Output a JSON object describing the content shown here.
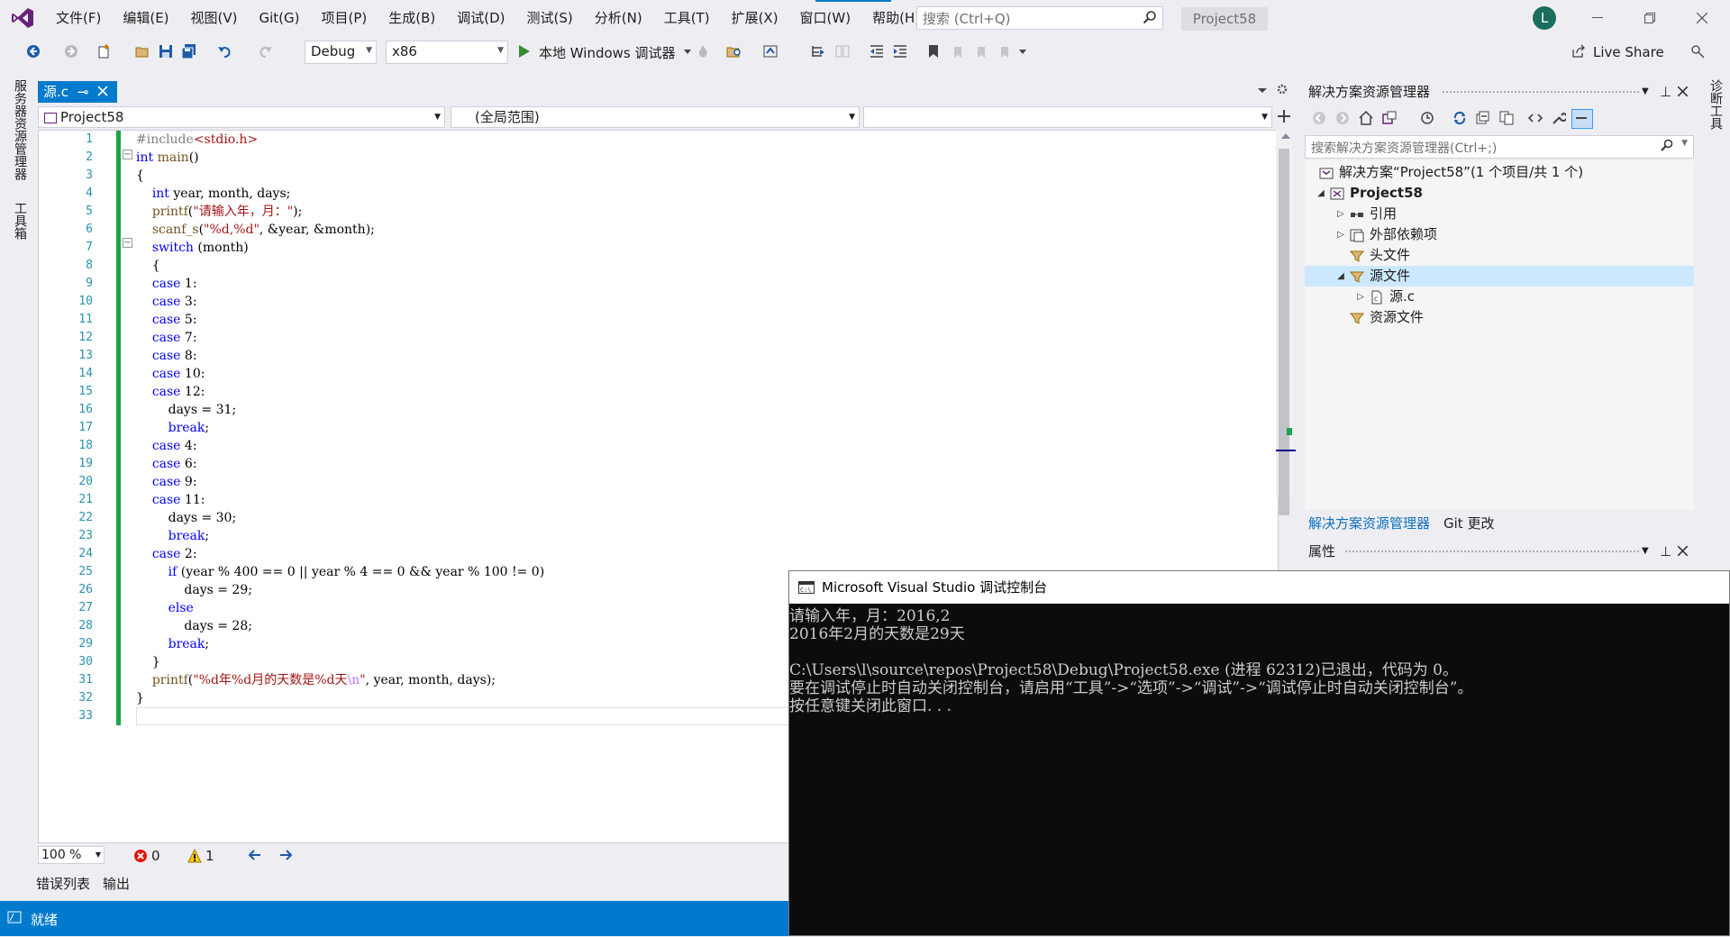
{
  "menu": {
    "items": [
      "文件(F)",
      "编辑(E)",
      "视图(V)",
      "Git(G)",
      "项目(P)",
      "生成(B)",
      "调试(D)",
      "测试(S)",
      "分析(N)",
      "工具(T)",
      "扩展(X)",
      "窗口(W)",
      "帮助(H)"
    ]
  },
  "search": {
    "placeholder": "搜索 (Ctrl+Q)"
  },
  "title": {
    "project": "Project58",
    "avatar_letter": "L"
  },
  "toolbar": {
    "config": "Debug",
    "platform": "x86",
    "run_label": "本地 Windows 调试器",
    "live_share": "Live Share"
  },
  "left_tabs": [
    "服务器资源管理器",
    "工具箱"
  ],
  "editor": {
    "tab_label": "源.c",
    "nav_project": "Project58",
    "nav_scope": "(全局范围)",
    "nav_member": "",
    "zoom": "100 %",
    "errors": "0",
    "warnings": "1",
    "line_numbers": [
      "1",
      "2",
      "3",
      "4",
      "5",
      "6",
      "7",
      "8",
      "9",
      "10",
      "11",
      "12",
      "13",
      "14",
      "15",
      "16",
      "17",
      "18",
      "19",
      "20",
      "21",
      "22",
      "23",
      "24",
      "25",
      "26",
      "27",
      "28",
      "29",
      "30",
      "31",
      "32",
      "33"
    ]
  },
  "bottom_tabs": [
    "错误列表",
    "输出"
  ],
  "status": {
    "text": "就绪"
  },
  "solution_explorer": {
    "title": "解决方案资源管理器",
    "search_placeholder": "搜索解决方案资源管理器(Ctrl+;)",
    "tree": [
      {
        "label": "解决方案“Project58”(1 个项目/共 1 个)"
      },
      {
        "label": "Project58"
      },
      {
        "label": "引用"
      },
      {
        "label": "外部依赖项"
      },
      {
        "label": "头文件"
      },
      {
        "label": "源文件"
      },
      {
        "label": "源.c"
      },
      {
        "label": "资源文件"
      }
    ],
    "tabs": [
      "解决方案资源管理器",
      "Git 更改"
    ]
  },
  "properties": {
    "title": "属性"
  },
  "right_strip": {
    "label": "诊断工具"
  },
  "console": {
    "title": "Microsoft Visual Studio 调试控制台",
    "lines": [
      "请输入年，月：2016,2",
      "2016年2月的天数是29天",
      "",
      "C:\\Users\\l\\source\\repos\\Project58\\Debug\\Project58.exe (进程 62312)已退出，代码为 0。",
      "要在调试停止时自动关闭控制台，请启用“工具”->“选项”->“调试”->“调试停止时自动关闭控制台”。",
      "按任意键关闭此窗口. . ."
    ]
  },
  "colors": {
    "accent": "#007acc",
    "console_bg": "#0c0c0c",
    "change_bar": "#1ea34a",
    "keyword": "#0000ff",
    "string": "#a31515"
  }
}
